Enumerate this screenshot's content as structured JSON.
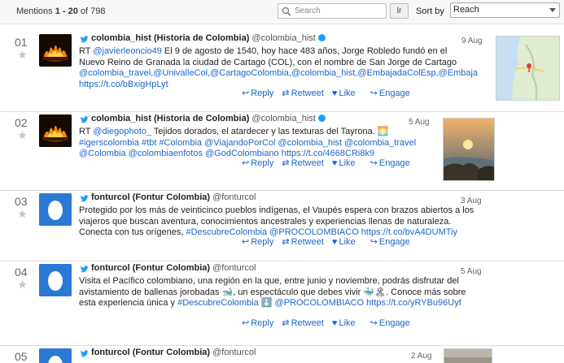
{
  "header": {
    "mentions_prefix": "Mentions ",
    "range": "1 - 20",
    "of_label": " of ",
    "total": "798",
    "search_placeholder": "Search",
    "lr_label": "lr",
    "sort_label": "Sort by",
    "sort_value": "Reach"
  },
  "actions": {
    "reply": "Reply",
    "retweet": "Retweet",
    "like": "Like",
    "engage": "Engage"
  },
  "mentions": [
    {
      "num": "01",
      "name": "colombia_hist (Historia de Colombia)",
      "handle": "@colombia_hist",
      "verified": true,
      "date": "9 Aug",
      "lines": [
        [
          {
            "t": "RT "
          },
          {
            "t": "@javierleoncio49",
            "link": true
          },
          {
            "t": " El 9 de agosto de 1540, hoy hace 483 años, Jorge Robledo fundó en el"
          }
        ],
        [
          {
            "t": "Nuevo Reino de Granada la ciudad de Cartago (COL), con el nombre de San Jorge de Cartago"
          }
        ],
        [
          {
            "t": "@colombia_travel,@UnivalleCol,@CartagoColombia,@colombia_hist,@EmbajadaColEsp,@Embaja",
            "link": true
          }
        ],
        [
          {
            "t": "https://t.co/bBxigHpLyt",
            "link": true
          }
        ]
      ],
      "avatar": "fire",
      "thumb": "map"
    },
    {
      "num": "02",
      "name": "colombia_hist (Historia de Colombia)",
      "handle": "@colombia_hist",
      "verified": true,
      "date": "5 Aug",
      "lines": [
        [
          {
            "t": "RT "
          },
          {
            "t": "@diegophoto_",
            "link": true
          },
          {
            "t": " Tejidos dorados, el atardecer y las texturas del Tayrona. 🌅"
          }
        ],
        [
          {
            "t": "#igerscolombia #tbt #Colombia @ViajandoPorCol @colombia_hist @colombia_travel",
            "link": true
          }
        ],
        [
          {
            "t": "@Colombia @colombiaenfotos @GodColombiano https://t.co/4668CRi8k9",
            "link": true
          }
        ]
      ],
      "avatar": "fire",
      "thumb": "coast"
    },
    {
      "num": "03",
      "name": "fonturcol (Fontur Colombia)",
      "handle": "@fonturcol",
      "verified": false,
      "date": "3 Aug",
      "lines": [
        [
          {
            "t": "Protegido por los más de veinticinco pueblos indígenas, el Vaupés espera con brazos abiertos a los"
          }
        ],
        [
          {
            "t": "viajeros que buscan aventura, conocimientos ancestrales y experiencias llenas de naturaleza."
          }
        ],
        [
          {
            "t": "Conecta con tus orígenes, "
          },
          {
            "t": "#DescubreColombia @PROCOLOMBIACO https://t.co/bvA4DUMTiy",
            "link": true
          }
        ]
      ],
      "avatar": "blue",
      "thumb": ""
    },
    {
      "num": "04",
      "name": "fonturcol (Fontur Colombia)",
      "handle": "@fonturcol",
      "verified": false,
      "date": "5 Aug",
      "lines": [
        [
          {
            "t": "Visita el Pacífico colombiano, una región en la que, entre junio y noviembre, podrás disfrutar del"
          }
        ],
        [
          {
            "t": "avistamiento de ballenas jorobadas 🐋, un espectáculo que debes vivir 🐳🏝. Conoce más sobre"
          }
        ],
        [
          {
            "t": "esta experiencia única y "
          },
          {
            "t": "#DescubreColombia ⬇️ @PROCOLOMBIACO https://t.co/yRYBu96Uyf",
            "link": true
          }
        ]
      ],
      "avatar": "blue",
      "thumb": ""
    },
    {
      "num": "05",
      "name": "fonturcol (Fontur Colombia)",
      "handle": "@fonturcol",
      "verified": false,
      "date": "2 Aug",
      "lines": [],
      "avatar": "blue",
      "thumb": "partial"
    }
  ]
}
